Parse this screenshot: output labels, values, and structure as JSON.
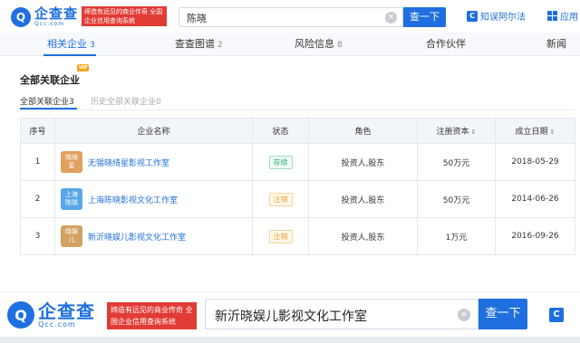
{
  "header": {
    "logo_mark": "Q",
    "logo_name": "企查查",
    "logo_domain": "Qcc.com",
    "slogan": "缔造有远见的商业传奇 全国企业信用查询系统",
    "search_value": "陈晓",
    "search_button": "查一下",
    "link_aier": "知误阿尔法",
    "link_app": "应用"
  },
  "tabs": [
    {
      "label": "相关企业",
      "count": "3"
    },
    {
      "label": "查查图谱",
      "count": "2"
    },
    {
      "label": "风险信息",
      "count": "8"
    },
    {
      "label": "合作伙伴",
      "count": ""
    },
    {
      "label": "新闻",
      "count": ""
    }
  ],
  "section": {
    "title": "全部关联企业",
    "vip_badge": "VIP",
    "subtab_active": "全部关联企业3",
    "subtab_other": "历史全部关联企业0"
  },
  "table": {
    "headers": {
      "index": "序号",
      "name": "企业名称",
      "status": "状态",
      "role": "角色",
      "capital": "注册资本",
      "date": "成立日期"
    },
    "rows": [
      {
        "index": "1",
        "thumb": "晓绮星",
        "thumb_color": "#e0a060",
        "name": "无锡晓绮星影视工作室",
        "status": "存续",
        "status_kind": "ok",
        "role": "投资人,股东",
        "capital": "50万元",
        "date": "2018-05-29"
      },
      {
        "index": "2",
        "thumb": "上海陈晓",
        "thumb_color": "#5aa6e8",
        "name": "上海陈晓影视文化工作室",
        "status": "注销",
        "status_kind": "cancel",
        "role": "投资人,股东",
        "capital": "50万元",
        "date": "2014-06-26"
      },
      {
        "index": "3",
        "thumb": "晓娱儿",
        "thumb_color": "#d2a262",
        "name": "新沂晓娱儿影视文化工作室",
        "status": "注销",
        "status_kind": "cancel",
        "role": "投资人,股东",
        "capital": "1万元",
        "date": "2016-09-26"
      }
    ]
  },
  "bottom": {
    "logo_mark": "Q",
    "logo_name": "企查查",
    "logo_domain": "Qcc.com",
    "slogan": "缔造有远见的商业传奇 全国企业信用查询系统",
    "search_value": "新沂晓娱儿影视文化工作室",
    "search_button": "查一下"
  },
  "colors": {
    "brand_blue": "#1f6fe0",
    "slogan_red": "#e23b35",
    "status_ok": "#2bb673",
    "status_cancel": "#f0a030"
  },
  "icons": {
    "clear": "close-circle-icon",
    "aier": "aier-logo-icon",
    "app": "app-grid-icon",
    "sort": "sort-icon"
  }
}
